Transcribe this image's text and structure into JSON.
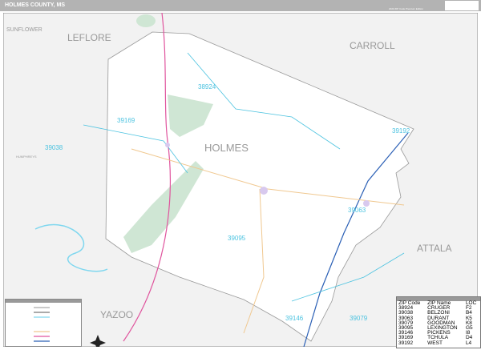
{
  "header": {
    "title": "HOLMES COUNTY, MS",
    "subtitle": "2020 ZIP Code Premium Edition"
  },
  "counties": [
    {
      "name": "SUNFLOWER"
    },
    {
      "name": "LEFLORE"
    },
    {
      "name": "CARROLL"
    },
    {
      "name": "HOLMES"
    },
    {
      "name": "ATTALA"
    },
    {
      "name": "YAZOO"
    },
    {
      "name": "HUMPHREYS"
    }
  ],
  "zip_labels": [
    "38924",
    "39169",
    "39038",
    "39192",
    "39063",
    "39095",
    "39146",
    "39079"
  ],
  "zip_table": {
    "headers": [
      "ZIP Code",
      "ZIP Name",
      "LOC"
    ],
    "rows": [
      [
        "38924",
        "CRUGER",
        "F2"
      ],
      [
        "39038",
        "BELZONI",
        "B4"
      ],
      [
        "39063",
        "DURANT",
        "K5"
      ],
      [
        "39079",
        "GOODMAN",
        "K8"
      ],
      [
        "39095",
        "LEXINGTON",
        "G5"
      ],
      [
        "39146",
        "PICKENS",
        "I8"
      ],
      [
        "39169",
        "TCHULA",
        "D4"
      ],
      [
        "39192",
        "WEST",
        "L4"
      ]
    ]
  },
  "colors": {
    "header": "#b3b3b3",
    "zip": "#4cc3e0",
    "highway": "#e0559e",
    "park": "#cfe6d4"
  }
}
